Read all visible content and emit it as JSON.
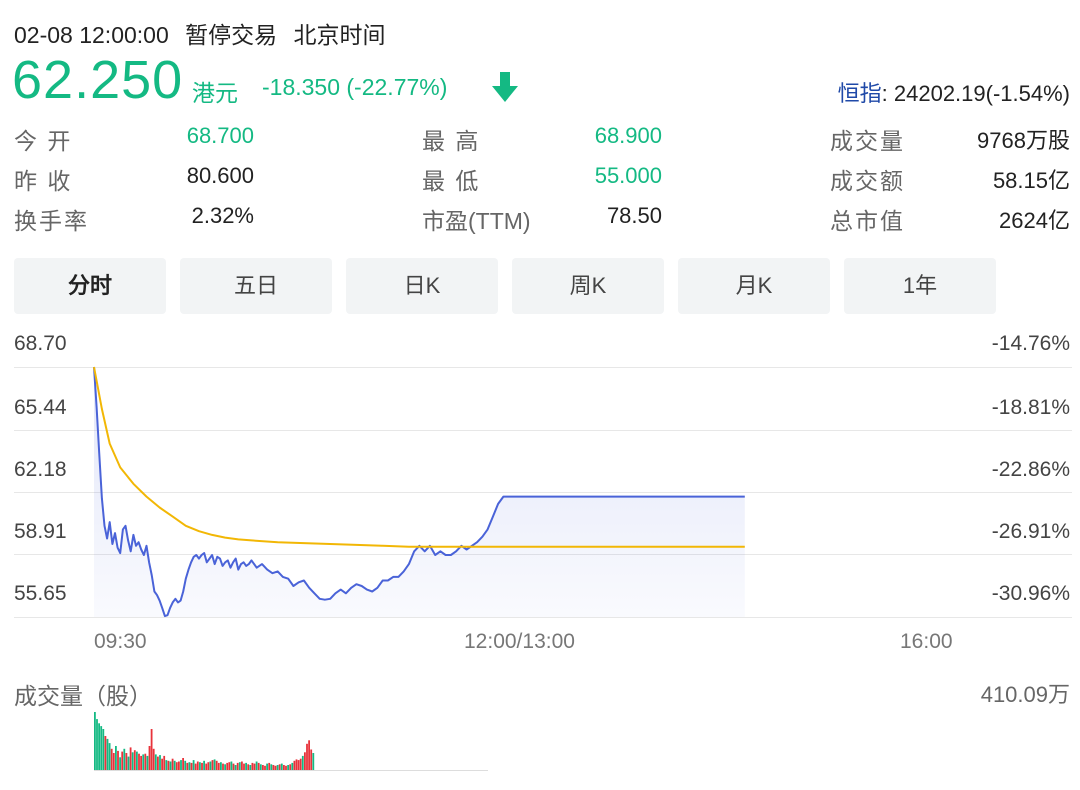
{
  "status": {
    "datetime": "02-08 12:00:00",
    "state": "暂停交易",
    "timezone": "北京时间"
  },
  "quote": {
    "price": "62.250",
    "currency": "港元",
    "change": "-18.350 (-22.77%)",
    "direction": "down"
  },
  "index": {
    "label": "恒指",
    "value": ": 24202.19(-1.54%)"
  },
  "stats": {
    "open": {
      "label": "今  开",
      "value": "68.700"
    },
    "prev_close": {
      "label": "昨  收",
      "value": "80.600"
    },
    "turnover_rate": {
      "label": "换手率",
      "value": "2.32%"
    },
    "high": {
      "label": "最  高",
      "value": "68.900"
    },
    "low": {
      "label": "最  低",
      "value": "55.000"
    },
    "pe": {
      "label": "市盈(TTM)",
      "value": "78.50"
    },
    "volume": {
      "label": "成交量",
      "value": "9768万股"
    },
    "amount": {
      "label": "成交额",
      "value": "58.15亿"
    },
    "market_cap": {
      "label": "总市值",
      "value": "2624亿"
    }
  },
  "tabs": [
    {
      "label": "分时",
      "active": true
    },
    {
      "label": "五日",
      "active": false
    },
    {
      "label": "日K",
      "active": false
    },
    {
      "label": "周K",
      "active": false
    },
    {
      "label": "月K",
      "active": false
    },
    {
      "label": "1年",
      "active": false
    }
  ],
  "colors": {
    "up": "#e8333b",
    "down": "#14b983",
    "price_line": "#4a63d8",
    "avg_line": "#f2b705",
    "index_label": "#1f49a8"
  },
  "chart_data": [
    {
      "type": "line",
      "title": "",
      "ylim": [
        55.0,
        68.7
      ],
      "y_ticks_left": [
        "68.70",
        "65.44",
        "62.18",
        "58.91",
        "55.65"
      ],
      "y_ticks_right": [
        "-14.76%",
        "-18.81%",
        "-22.86%",
        "-26.91%",
        "-30.96%"
      ],
      "x_ticks": [
        "09:30",
        "12:00/13:00",
        "16:00"
      ],
      "x_range_minutes": [
        0,
        330
      ],
      "grid": true,
      "series": [
        {
          "name": "",
          "role": "price",
          "color": "#4a63d8",
          "points": [
            [
              0,
              68.7
            ],
            [
              1,
              66.5
            ],
            [
              2,
              64.0
            ],
            [
              3,
              61.5
            ],
            [
              4,
              60.0
            ],
            [
              5,
              59.3
            ],
            [
              6,
              60.2
            ],
            [
              7,
              59.0
            ],
            [
              8,
              59.6
            ],
            [
              9,
              58.8
            ],
            [
              10,
              58.5
            ],
            [
              11,
              59.8
            ],
            [
              12,
              60.0
            ],
            [
              13,
              59.2
            ],
            [
              14,
              58.6
            ],
            [
              15,
              59.5
            ],
            [
              16,
              58.9
            ],
            [
              17,
              59.1
            ],
            [
              18,
              58.7
            ],
            [
              19,
              58.4
            ],
            [
              20,
              58.9
            ],
            [
              21,
              58.0
            ],
            [
              22,
              57.3
            ],
            [
              23,
              56.4
            ],
            [
              24,
              56.2
            ],
            [
              25,
              55.9
            ],
            [
              26,
              55.5
            ],
            [
              27,
              55.05
            ],
            [
              28,
              55.1
            ],
            [
              29,
              55.5
            ],
            [
              30,
              55.8
            ],
            [
              31,
              56.0
            ],
            [
              32,
              55.8
            ],
            [
              33,
              55.9
            ],
            [
              34,
              56.4
            ],
            [
              35,
              57.1
            ],
            [
              36,
              57.6
            ],
            [
              37,
              58.0
            ],
            [
              38,
              58.3
            ],
            [
              39,
              58.4
            ],
            [
              40,
              58.2
            ],
            [
              41,
              58.4
            ],
            [
              42,
              58.5
            ],
            [
              43,
              58.0
            ],
            [
              44,
              58.2
            ],
            [
              45,
              58.4
            ],
            [
              46,
              57.9
            ],
            [
              47,
              58.3
            ],
            [
              48,
              58.2
            ],
            [
              49,
              57.8
            ],
            [
              50,
              58.0
            ],
            [
              51,
              58.1
            ],
            [
              52,
              57.7
            ],
            [
              53,
              58.0
            ],
            [
              54,
              58.2
            ],
            [
              55,
              57.6
            ],
            [
              56,
              57.9
            ],
            [
              57,
              58.0
            ],
            [
              58,
              57.8
            ],
            [
              59,
              57.9
            ],
            [
              60,
              58.1
            ],
            [
              62,
              57.7
            ],
            [
              64,
              57.9
            ],
            [
              66,
              57.6
            ],
            [
              68,
              57.4
            ],
            [
              70,
              57.5
            ],
            [
              72,
              57.2
            ],
            [
              74,
              57.1
            ],
            [
              76,
              56.7
            ],
            [
              78,
              56.9
            ],
            [
              80,
              57.0
            ],
            [
              82,
              56.6
            ],
            [
              84,
              56.3
            ],
            [
              86,
              56.0
            ],
            [
              88,
              55.95
            ],
            [
              90,
              56.0
            ],
            [
              92,
              56.3
            ],
            [
              94,
              56.5
            ],
            [
              96,
              56.3
            ],
            [
              98,
              56.6
            ],
            [
              100,
              56.8
            ],
            [
              102,
              56.7
            ],
            [
              104,
              56.5
            ],
            [
              106,
              56.4
            ],
            [
              108,
              56.6
            ],
            [
              110,
              57.0
            ],
            [
              112,
              57.0
            ],
            [
              114,
              57.2
            ],
            [
              116,
              57.2
            ],
            [
              118,
              57.5
            ],
            [
              120,
              57.9
            ],
            [
              122,
              58.6
            ],
            [
              124,
              58.9
            ],
            [
              126,
              58.6
            ],
            [
              128,
              58.9
            ],
            [
              130,
              58.4
            ],
            [
              132,
              58.6
            ],
            [
              134,
              58.4
            ],
            [
              136,
              58.4
            ],
            [
              138,
              58.6
            ],
            [
              140,
              58.9
            ],
            [
              142,
              58.7
            ],
            [
              144,
              58.9
            ],
            [
              146,
              59.1
            ],
            [
              148,
              59.4
            ],
            [
              150,
              59.8
            ],
            [
              152,
              60.5
            ],
            [
              154,
              61.2
            ],
            [
              156,
              61.6
            ],
            [
              158,
              61.6
            ],
            [
              160,
              61.6
            ],
            [
              170,
              61.6
            ],
            [
              180,
              61.6
            ],
            [
              190,
              61.6
            ],
            [
              200,
              61.6
            ],
            [
              210,
              61.6
            ],
            [
              220,
              61.6
            ],
            [
              230,
              61.6
            ],
            [
              240,
              61.6
            ],
            [
              248,
              61.6
            ]
          ]
        },
        {
          "name": "",
          "role": "average",
          "color": "#f2b705",
          "points": [
            [
              0,
              68.7
            ],
            [
              3,
              66.4
            ],
            [
              6,
              64.5
            ],
            [
              10,
              63.2
            ],
            [
              15,
              62.3
            ],
            [
              20,
              61.6
            ],
            [
              25,
              61.0
            ],
            [
              30,
              60.5
            ],
            [
              35,
              60.0
            ],
            [
              40,
              59.7
            ],
            [
              45,
              59.5
            ],
            [
              50,
              59.35
            ],
            [
              55,
              59.25
            ],
            [
              60,
              59.2
            ],
            [
              70,
              59.1
            ],
            [
              80,
              59.05
            ],
            [
              90,
              59.0
            ],
            [
              100,
              58.95
            ],
            [
              110,
              58.9
            ],
            [
              120,
              58.85
            ],
            [
              130,
              58.85
            ],
            [
              140,
              58.85
            ],
            [
              150,
              58.85
            ],
            [
              160,
              58.85
            ],
            [
              180,
              58.85
            ],
            [
              200,
              58.85
            ],
            [
              220,
              58.85
            ],
            [
              248,
              58.85
            ]
          ]
        }
      ]
    },
    {
      "type": "bar",
      "title": "成交量（股）",
      "max_label": "410.09万",
      "note": "bars alternate red (up) / green (down) per minute",
      "volumes": [
        4100,
        3600,
        3300,
        3100,
        2900,
        2400,
        2200,
        1900,
        1500,
        1200,
        1700,
        1350,
        900,
        1300,
        1500,
        1200,
        950,
        1600,
        1250,
        1400,
        1300,
        1150,
        1000,
        1100,
        1150,
        1000,
        1700,
        2900,
        1500,
        1100,
        950,
        1050,
        800,
        1000,
        700,
        650,
        600,
        800,
        650,
        550,
        600,
        700,
        850,
        650,
        500,
        550,
        500,
        700,
        450,
        600,
        550,
        500,
        650,
        450,
        550,
        600,
        700,
        750,
        650,
        500,
        550,
        450,
        400,
        500,
        550,
        600,
        450,
        350,
        500,
        550,
        600,
        450,
        500,
        400,
        350,
        500,
        450,
        600,
        500,
        400,
        350,
        300,
        450,
        500,
        400,
        350,
        300,
        350,
        400,
        450,
        350,
        300,
        350,
        400,
        500,
        650,
        750,
        700,
        800,
        1000,
        1250,
        1850,
        2100,
        1450,
        1200
      ],
      "colors_up_down": [
        "d",
        "d",
        "d",
        "d",
        "d",
        "u",
        "d",
        "d",
        "u",
        "u",
        "d",
        "u",
        "d",
        "u",
        "d",
        "u",
        "d",
        "u",
        "d",
        "u",
        "d",
        "u",
        "u",
        "d",
        "u",
        "d",
        "u",
        "u",
        "u",
        "d",
        "u",
        "d",
        "u",
        "u",
        "d",
        "u",
        "d",
        "u",
        "d",
        "u",
        "u",
        "d",
        "u",
        "d",
        "u",
        "d",
        "u",
        "d",
        "u",
        "u",
        "d",
        "u",
        "d",
        "u",
        "u",
        "d",
        "u",
        "d",
        "u",
        "u",
        "d",
        "u",
        "d",
        "u",
        "u",
        "d",
        "u",
        "d",
        "u",
        "d",
        "u",
        "u",
        "d",
        "u",
        "d",
        "u",
        "u",
        "d",
        "u",
        "d",
        "u",
        "u",
        "d",
        "u",
        "d",
        "u",
        "u",
        "d",
        "u",
        "d",
        "u",
        "u",
        "d",
        "u",
        "d",
        "u",
        "u",
        "u",
        "u",
        "d",
        "u",
        "u",
        "u",
        "u",
        "d"
      ]
    }
  ]
}
